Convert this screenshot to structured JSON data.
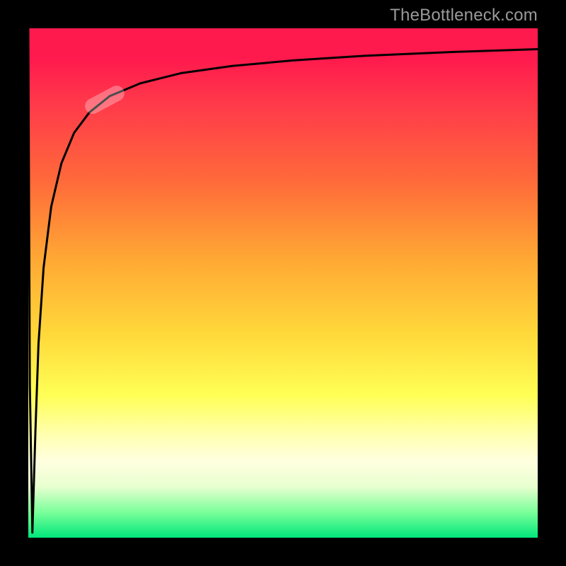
{
  "attribution": "TheBottleneck.com",
  "colors": {
    "gradient_top": "#ff1a4d",
    "gradient_bottom": "#00e67a",
    "curve_stroke": "#000000",
    "marker_fill": "rgba(255,255,255,0.30)"
  },
  "chart_data": {
    "type": "line",
    "title": "",
    "xlabel": "",
    "ylabel": "",
    "xlim": [
      0,
      100
    ],
    "ylim": [
      -100,
      0
    ],
    "series": [
      {
        "name": "curve",
        "x": [
          0.0,
          0.3,
          0.8,
          1.4,
          2.0,
          3.0,
          4.5,
          6.5,
          9.0,
          12.0,
          16.0,
          22.0,
          30.0,
          40.0,
          52.0,
          66.0,
          82.0,
          100.0
        ],
        "y": [
          0.0,
          -70.0,
          -99.0,
          -79.0,
          -62.0,
          -47.0,
          -35.0,
          -26.5,
          -20.5,
          -16.5,
          -13.3,
          -10.8,
          -8.8,
          -7.4,
          -6.3,
          -5.4,
          -4.7,
          -4.1
        ]
      }
    ],
    "marker": {
      "x": 15.0,
      "y": -14.0,
      "angle_deg": -28
    }
  }
}
